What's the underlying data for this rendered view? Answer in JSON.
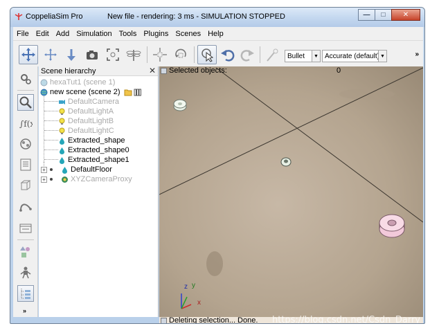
{
  "window": {
    "app_title": "CoppeliaSim Pro",
    "doc_title": "New file - rendering: 3 ms - SIMULATION STOPPED",
    "minimize_label": "—",
    "maximize_label": "□",
    "close_label": "✕"
  },
  "menu": [
    "File",
    "Edit",
    "Add",
    "Simulation",
    "Tools",
    "Plugins",
    "Scenes",
    "Help"
  ],
  "toolbar": {
    "engine_value": "Bullet",
    "accuracy_value": "Accurate (default)",
    "overflow_label": "»"
  },
  "left_toolbar": {
    "overflow_label": "»"
  },
  "hierarchy": {
    "title": "Scene hierarchy",
    "close_label": "✕",
    "scenes": [
      {
        "label": "hexaTut1 (scene 1)"
      },
      {
        "label": "new scene (scene 2)"
      }
    ],
    "items": [
      {
        "label": "DefaultCamera"
      },
      {
        "label": "DefaultLightA"
      },
      {
        "label": "DefaultLightB"
      },
      {
        "label": "DefaultLightC"
      },
      {
        "label": "Extracted_shape"
      },
      {
        "label": "Extracted_shape0"
      },
      {
        "label": "Extracted_shape1"
      },
      {
        "label": "DefaultFloor"
      },
      {
        "label": "XYZCameraProxy"
      }
    ]
  },
  "viewport": {
    "selected_label": "Selected objects:",
    "selected_count": "0",
    "axis_x": "x",
    "axis_y": "y",
    "axis_z": "z"
  },
  "status": {
    "message": "Deleting selection... Done.",
    "watermark": "https://blog.csdn.net/Csdn_Darry"
  },
  "colors": {
    "title_bar": "#c3d7ef",
    "close_button": "#c7432a",
    "floor": "#b9a893",
    "selected_shape": "#f2c9da"
  }
}
